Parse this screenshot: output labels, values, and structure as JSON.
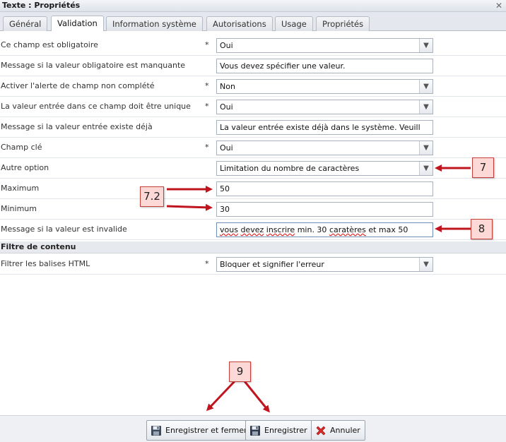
{
  "window": {
    "title": "Texte : Propriétés",
    "close_glyph": "✕"
  },
  "tabs": [
    {
      "label": "Général",
      "active": false
    },
    {
      "label": "Validation",
      "active": true
    },
    {
      "label": "Information système",
      "active": false
    },
    {
      "label": "Autorisations",
      "active": false
    },
    {
      "label": "Usage",
      "active": false
    },
    {
      "label": "Propriétés",
      "active": false
    }
  ],
  "rows": [
    {
      "label": "Ce champ est obligatoire",
      "required": "*",
      "type": "select",
      "value": "Oui"
    },
    {
      "label": "Message si la valeur obligatoire est manquante",
      "required": "",
      "type": "text",
      "value": "Vous devez spécifier une valeur."
    },
    {
      "label": "Activer l'alerte de champ non complété",
      "required": "*",
      "type": "select",
      "value": "Non"
    },
    {
      "label": "La valeur entrée dans ce champ doit être unique",
      "required": "*",
      "type": "select",
      "value": "Oui"
    },
    {
      "label": "Message si la valeur entrée existe déjà",
      "required": "",
      "type": "text",
      "value": "La valeur entrée existe déjà  dans le système. Veuill"
    },
    {
      "label": "Champ clé",
      "required": "*",
      "type": "select",
      "value": "Oui"
    },
    {
      "label": "Autre option",
      "required": "",
      "type": "select",
      "value": "Limitation du nombre de caractères"
    },
    {
      "label": "Maximum",
      "required": "",
      "type": "text",
      "value": "50"
    },
    {
      "label": "Minimum",
      "required": "",
      "type": "text",
      "value": "30"
    },
    {
      "label": "Message si la valeur est invalide",
      "required": "",
      "type": "text",
      "value": "vous devez inscrire min. 30 caratères et max 50"
    }
  ],
  "invalid_message_parts": {
    "w1": "vous",
    "w2": "devez",
    "w3": "inscrire",
    "rest": " min. 30 ",
    "w4": "caratères",
    "tail": " et max 50"
  },
  "section": {
    "title": "Filtre de contenu"
  },
  "content_filter": {
    "label": "Filtrer les balises HTML",
    "required": "*",
    "value": "Bloquer et signifier l'erreur"
  },
  "callouts": {
    "c7": "7",
    "c72": "7.2",
    "c8": "8",
    "c9": "9"
  },
  "buttons": {
    "save_close": "Enregistrer et fermer",
    "save": "Enregistrer",
    "cancel": "Annuler"
  },
  "icons": {
    "dropdown": "chevron-down-icon",
    "save": "floppy-disk-icon",
    "cancel": "red-x-icon"
  },
  "colors": {
    "arrow": "#c0141e",
    "callout_fill": "#fcd9d6",
    "callout_border": "#c2413a"
  }
}
